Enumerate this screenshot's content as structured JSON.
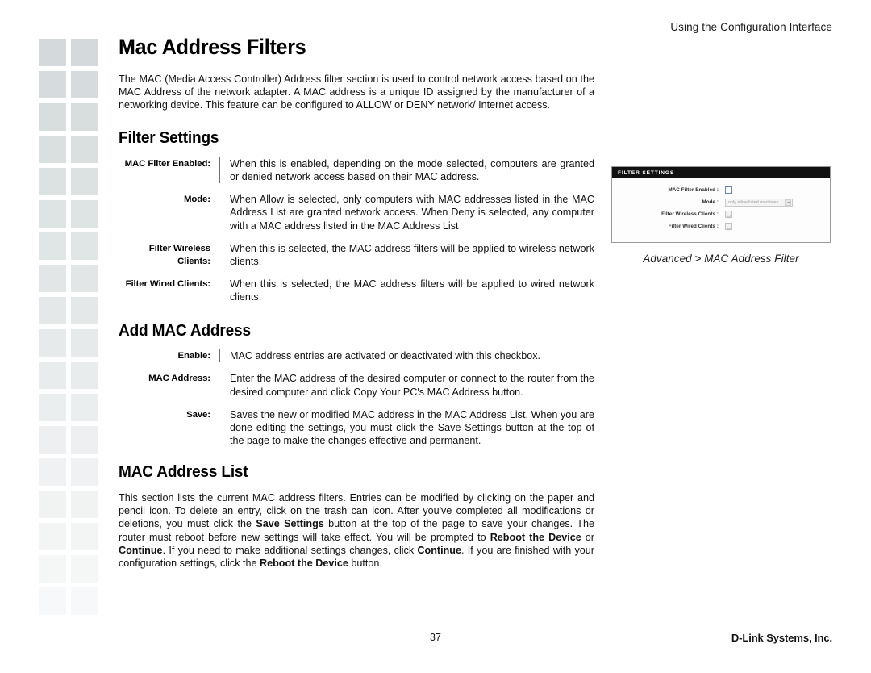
{
  "header": {
    "running_head": "Using the Configuration Interface"
  },
  "page_title": "Mac Address Filters",
  "intro_paragraph": "The MAC (Media Access Controller) Address filter section is used to control network access based on the MAC Address of the network adapter. A MAC address is a unique ID assigned by the manufacturer of a networking device. This feature can be configured to ALLOW or DENY network/ Internet access.",
  "sections": [
    {
      "heading": "Filter Settings",
      "items": [
        {
          "term": "MAC Filter Enabled:",
          "description": "When this is enabled, depending on the mode selected, computers are granted or denied network access based on their MAC address."
        },
        {
          "term": "Mode:",
          "description": "When Allow is selected, only computers with MAC addresses listed in the MAC Address List are granted network access. When Deny is selected, any computer with a MAC address listed in the MAC Address List"
        },
        {
          "term": "Filter Wireless Clients:",
          "description": "When this is selected, the MAC address filters will be applied to wireless network clients."
        },
        {
          "term": "Filter Wired Clients:",
          "description": "When this is selected, the MAC address filters will be applied to wired network clients."
        }
      ]
    },
    {
      "heading": "Add MAC Address",
      "items": [
        {
          "term": "Enable:",
          "description": "MAC address entries are activated or deactivated with this checkbox."
        },
        {
          "term": "MAC Address:",
          "description": "Enter the MAC address of the desired computer or connect to the router from the desired computer and click Copy Your PC's MAC Address button."
        },
        {
          "term": "Save:",
          "description": "Saves the new or modified MAC address in the MAC Address List. When you are done editing the settings, you must click the Save Settings button at the top of the page to make the changes effective and permanent."
        }
      ]
    }
  ],
  "mac_address_list": {
    "heading": "MAC Address List",
    "paragraph_parts": [
      {
        "text": "This section lists the current MAC address filters. Entries can be modified by clicking on the paper and pencil icon. To delete an entry, click on the trash can icon. After you've completed all modifications or deletions, you must click the ",
        "bold": false
      },
      {
        "text": "Save Settings",
        "bold": true
      },
      {
        "text": " button at the top of the page to save your changes. The router must reboot before new settings will take effect. You will be prompted to ",
        "bold": false
      },
      {
        "text": "Reboot the Device",
        "bold": true
      },
      {
        "text": " or ",
        "bold": false
      },
      {
        "text": "Continue",
        "bold": true
      },
      {
        "text": ". If you need to make additional settings changes, click ",
        "bold": false
      },
      {
        "text": "Continue",
        "bold": true
      },
      {
        "text": ". If you are finished with your configuration settings, click the ",
        "bold": false
      },
      {
        "text": "Reboot the Device",
        "bold": true
      },
      {
        "text": " button.",
        "bold": false
      }
    ]
  },
  "figure": {
    "panel_title": "FILTER SETTINGS",
    "rows": [
      {
        "label": "MAC Filter Enabled :",
        "control": "checkbox",
        "state": "unchecked"
      },
      {
        "label": "Mode :",
        "control": "select",
        "value": "only allow listed machines"
      },
      {
        "label": "Filter Wireless Clients :",
        "control": "checkbox",
        "state": "disabled-checked"
      },
      {
        "label": "Filter Wired Clients :",
        "control": "checkbox",
        "state": "disabled-checked"
      }
    ],
    "caption": "Advanced > MAC Address Filter"
  },
  "footer": {
    "page_number": "37",
    "company": "D-Link Systems, Inc."
  },
  "decoration": {
    "square_color": "#d4dadb",
    "rows": 18,
    "columns": 2
  }
}
